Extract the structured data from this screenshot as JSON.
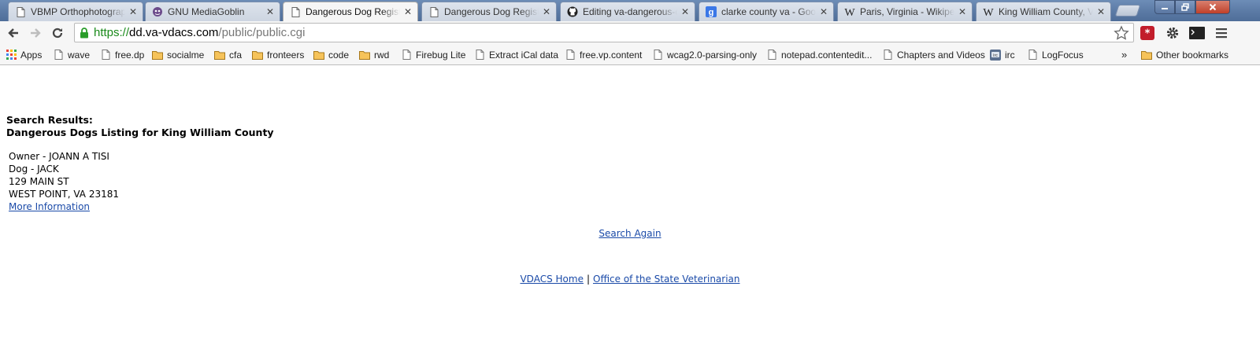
{
  "browser": {
    "tabs": [
      {
        "title": "VBMP Orthophotograph",
        "icon": "page-icon",
        "active": false
      },
      {
        "title": "GNU MediaGoblin",
        "icon": "goblin-icon",
        "active": false
      },
      {
        "title": "Dangerous Dog Registry",
        "icon": "page-icon",
        "active": true
      },
      {
        "title": "Dangerous Dog Registry",
        "icon": "page-icon",
        "active": false
      },
      {
        "title": "Editing va-dangerous-d",
        "icon": "github-icon",
        "active": false
      },
      {
        "title": "clarke county va - Goog",
        "icon": "google-icon",
        "active": false
      },
      {
        "title": "Paris, Virginia - Wikiped",
        "icon": "wikipedia-icon",
        "active": false
      },
      {
        "title": "King William County, Vi",
        "icon": "wikipedia-icon",
        "active": false
      }
    ],
    "url": {
      "scheme": "https://",
      "host": "dd.va-vdacs.com",
      "path": "/public/public.cgi"
    },
    "bookmarks": [
      {
        "label": "Apps",
        "icon": "apps-grid-icon"
      },
      {
        "label": "wave",
        "icon": "page-icon"
      },
      {
        "label": "free.dp",
        "icon": "page-icon"
      },
      {
        "label": "socialme",
        "icon": "folder-icon"
      },
      {
        "label": "cfa",
        "icon": "folder-icon"
      },
      {
        "label": "fronteers",
        "icon": "folder-icon"
      },
      {
        "label": "code",
        "icon": "folder-icon"
      },
      {
        "label": "rwd",
        "icon": "folder-icon"
      },
      {
        "label": "Firebug Lite",
        "icon": "page-icon"
      },
      {
        "label": "Extract iCal data",
        "icon": "page-icon"
      },
      {
        "label": "free.vp.content",
        "icon": "page-icon"
      },
      {
        "label": "wcag2.0-parsing-only",
        "icon": "page-icon"
      },
      {
        "label": "notepad.contentedit...",
        "icon": "page-icon"
      },
      {
        "label": "Chapters and Videos",
        "icon": "page-icon"
      },
      {
        "label": "irc",
        "icon": "irc-icon"
      },
      {
        "label": "LogFocus",
        "icon": "page-icon"
      }
    ],
    "overflow_label": "»",
    "other_bookmarks": "Other bookmarks",
    "colors": {
      "scheme_green": "#1a8a1a",
      "link_blue": "#1a4aa8",
      "tab_strip": "#5b7aa5"
    }
  },
  "page": {
    "heading_line1": "Search Results:",
    "heading_line2": "Dangerous Dogs Listing for King William County",
    "record": {
      "owner": "Owner - JOANN A TISI",
      "dog": "Dog - JACK",
      "street": "129 MAIN ST",
      "city": "WEST POINT, VA 23181",
      "more_info": "More Information"
    },
    "search_again": "Search Again",
    "footer": {
      "home_link": "VDACS Home",
      "separator": "|",
      "vet_link": "Office of the State Veterinarian"
    }
  }
}
